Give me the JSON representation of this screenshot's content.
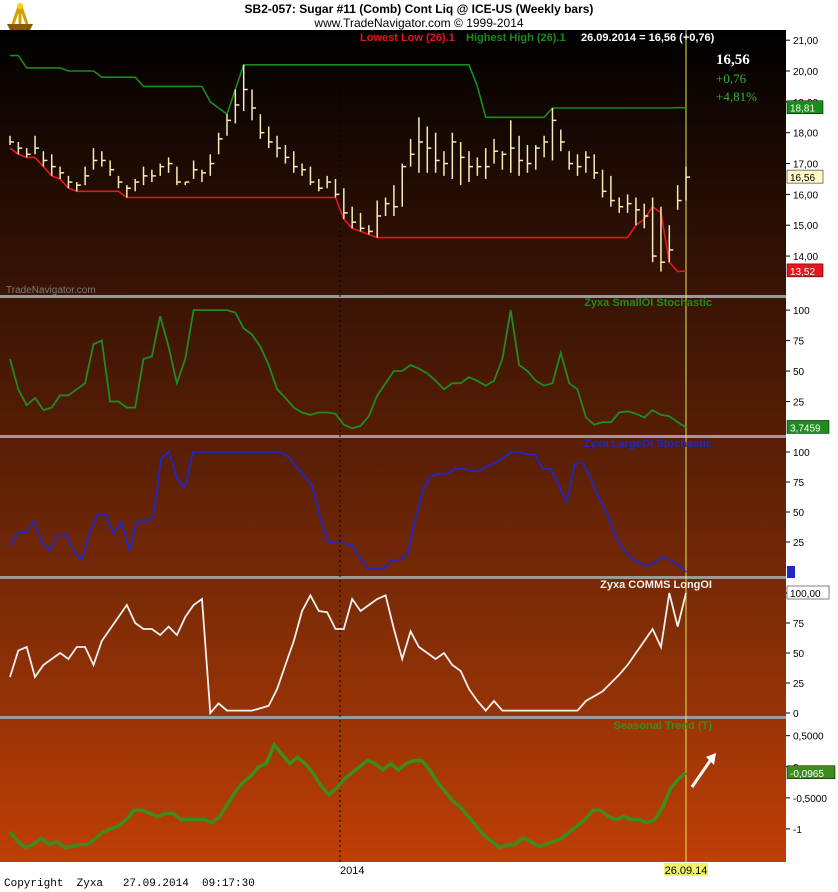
{
  "header": {
    "title": "SB2-057:  Sugar #11 (Comb) Cont Liq @ ICE-US  (Weekly bars)",
    "subtitle": "www.TradeNavigator.com © 1999-2014"
  },
  "footer": {
    "copyright": "Copyright  Zyxa   27.09.2014  09:17:30"
  },
  "colors": {
    "price_bar": "#f4eeb4",
    "lowest_low": "#e8141e",
    "highest_high": "#198c19",
    "small_oi": "#1e8c1e",
    "large_oi": "#1e28c8",
    "comms": "#f0f0f0",
    "seasonal": "#3c8c1e",
    "cursor": "#e6e650",
    "separator": "#9a9a9a"
  },
  "chart_data": [
    {
      "type": "ohlc",
      "panel": "price",
      "legend": {
        "lowest_low": "Lowest Low (26).1",
        "highest_high": "Highest High (26).1",
        "cursor_info": "26.09.2014 = 16,56 (+0,76)"
      },
      "watermark": "TradeNavigator.com",
      "quote": {
        "last": "16,56",
        "change": "+0,76",
        "change_pct": "+4,81%"
      },
      "ylim": [
        12.9,
        21.2
      ],
      "yticks": [
        "21,00",
        "20,00",
        "19,00",
        "18,00",
        "17,00",
        "16,00",
        "15,00",
        "14,00"
      ],
      "year_marker": "2014",
      "cursor_date": "26.09.14",
      "bars_high": [
        17.9,
        17.7,
        17.5,
        17.9,
        17.4,
        17.3,
        16.9,
        16.6,
        16.4,
        16.9,
        17.5,
        17.4,
        17.1,
        16.6,
        16.3,
        16.5,
        16.9,
        16.8,
        17.0,
        17.2,
        16.9,
        16.4,
        17.1,
        16.8,
        17.3,
        18.0,
        18.6,
        19.4,
        20.2,
        19.4,
        18.6,
        18.2,
        17.9,
        17.6,
        17.4,
        17.0,
        16.9,
        16.5,
        16.6,
        16.5,
        16.2,
        15.6,
        15.4,
        15.0,
        15.8,
        15.9,
        16.3,
        17.0,
        17.8,
        18.5,
        18.2,
        18.0,
        17.4,
        18.0,
        17.7,
        17.4,
        17.2,
        17.5,
        17.8,
        17.4,
        18.4,
        17.9,
        17.6,
        17.6,
        17.9,
        18.8,
        18.1,
        17.4,
        17.3,
        17.4,
        17.3,
        16.8,
        16.6,
        15.9,
        16.0,
        15.9,
        15.7,
        15.9,
        15.6,
        15.0,
        16.3,
        16.9
      ],
      "bars_low": [
        17.6,
        17.3,
        17.2,
        17.3,
        16.9,
        16.6,
        16.5,
        16.2,
        16.1,
        16.3,
        16.8,
        16.9,
        16.6,
        16.2,
        15.9,
        16.1,
        16.3,
        16.4,
        16.6,
        16.7,
        16.3,
        16.3,
        16.5,
        16.4,
        16.6,
        17.3,
        17.9,
        18.3,
        18.7,
        18.4,
        17.8,
        17.5,
        17.2,
        17.0,
        16.7,
        16.6,
        16.3,
        16.1,
        16.2,
        15.9,
        15.2,
        14.9,
        14.8,
        14.7,
        14.6,
        15.3,
        15.3,
        15.6,
        16.9,
        16.7,
        16.7,
        16.7,
        16.6,
        16.5,
        16.3,
        16.4,
        16.6,
        16.5,
        17.0,
        16.8,
        16.7,
        16.6,
        16.7,
        16.8,
        17.2,
        17.1,
        17.4,
        16.8,
        16.6,
        16.7,
        16.5,
        15.9,
        15.6,
        15.4,
        15.4,
        15.0,
        14.9,
        13.8,
        13.5,
        13.8,
        15.5,
        15.8
      ],
      "bars_close": [
        17.7,
        17.5,
        17.3,
        17.5,
        17.1,
        16.9,
        16.7,
        16.4,
        16.3,
        16.6,
        17.1,
        17.1,
        16.8,
        16.4,
        16.2,
        16.4,
        16.6,
        16.6,
        16.9,
        17.0,
        16.4,
        16.4,
        16.8,
        16.7,
        17.0,
        17.8,
        18.4,
        18.9,
        19.4,
        18.8,
        18.0,
        17.7,
        17.5,
        17.2,
        16.9,
        16.8,
        16.4,
        16.2,
        16.4,
        16.0,
        15.4,
        15.1,
        14.9,
        14.8,
        15.3,
        15.7,
        15.6,
        16.9,
        17.3,
        17.7,
        17.5,
        17.1,
        17.0,
        17.7,
        17.2,
        16.9,
        16.9,
        16.9,
        17.4,
        17.3,
        17.5,
        17.1,
        17.0,
        17.5,
        17.7,
        18.4,
        17.7,
        17.0,
        16.9,
        17.2,
        16.7,
        16.1,
        15.8,
        15.6,
        15.7,
        15.5,
        15.3,
        14.0,
        13.8,
        14.2,
        15.8,
        16.56
      ],
      "lowest_low": [
        17.5,
        17.3,
        17.2,
        17.2,
        16.9,
        16.6,
        16.5,
        16.2,
        16.1,
        16.1,
        16.1,
        16.1,
        16.1,
        16.1,
        15.9,
        15.9,
        15.9,
        15.9,
        15.9,
        15.9,
        15.9,
        15.9,
        15.9,
        15.9,
        15.9,
        15.9,
        15.9,
        15.9,
        15.9,
        15.9,
        15.9,
        15.9,
        15.9,
        15.9,
        15.9,
        15.9,
        15.9,
        15.9,
        15.9,
        15.9,
        15.2,
        14.9,
        14.8,
        14.7,
        14.6,
        14.6,
        14.6,
        14.6,
        14.6,
        14.6,
        14.6,
        14.6,
        14.6,
        14.6,
        14.6,
        14.6,
        14.6,
        14.6,
        14.6,
        14.6,
        14.6,
        14.6,
        14.6,
        14.6,
        14.6,
        14.6,
        14.6,
        14.6,
        14.6,
        14.6,
        14.6,
        14.6,
        14.6,
        14.6,
        14.6,
        15.0,
        15.2,
        15.6,
        15.4,
        13.8,
        13.5,
        13.52
      ],
      "highest_high": [
        20.5,
        20.5,
        20.1,
        20.1,
        20.1,
        20.1,
        20.1,
        20.0,
        20.0,
        20.0,
        20.0,
        19.8,
        19.8,
        19.8,
        19.8,
        19.8,
        19.5,
        19.5,
        19.5,
        19.5,
        19.5,
        19.5,
        19.5,
        19.5,
        19.0,
        18.8,
        18.6,
        19.4,
        20.2,
        20.2,
        20.2,
        20.2,
        20.2,
        20.2,
        20.2,
        20.2,
        20.2,
        20.2,
        20.2,
        20.2,
        20.2,
        20.2,
        20.2,
        20.2,
        20.2,
        20.2,
        20.2,
        20.2,
        20.2,
        20.2,
        20.2,
        20.2,
        20.2,
        20.2,
        20.2,
        20.2,
        19.5,
        18.5,
        18.5,
        18.5,
        18.5,
        18.5,
        18.5,
        18.5,
        18.5,
        18.8,
        18.8,
        18.8,
        18.8,
        18.8,
        18.8,
        18.8,
        18.8,
        18.8,
        18.8,
        18.8,
        18.8,
        18.8,
        18.8,
        18.8,
        18.81,
        18.81
      ],
      "value_tags": {
        "highest_high": "18,81",
        "lowest_low": "13,52",
        "last": "16,56"
      }
    },
    {
      "type": "line",
      "panel": "small_oi",
      "title": "Zyxa SmallOI Stochastic",
      "ylim": [
        0,
        105
      ],
      "yticks": [
        "100",
        "75",
        "50",
        "25"
      ],
      "values": [
        60,
        35,
        22,
        28,
        18,
        20,
        30,
        30,
        35,
        40,
        72,
        75,
        25,
        25,
        20,
        20,
        60,
        62,
        95,
        70,
        40,
        60,
        100,
        100,
        100,
        100,
        100,
        98,
        85,
        80,
        70,
        55,
        35,
        28,
        20,
        16,
        14,
        16,
        16,
        15,
        6,
        3,
        5,
        13,
        30,
        40,
        50,
        50,
        55,
        52,
        48,
        42,
        35,
        40,
        40,
        45,
        42,
        38,
        42,
        60,
        100,
        55,
        50,
        42,
        38,
        40,
        65,
        40,
        35,
        12,
        6,
        8,
        8,
        16,
        17,
        15,
        12,
        18,
        14,
        13,
        8,
        3.7459
      ],
      "value_tag": "3,7459"
    },
    {
      "type": "line",
      "panel": "large_oi",
      "title": "Zyxa LargeOI Stochastic",
      "ylim": [
        0,
        105
      ],
      "yticks": [
        "100",
        "75",
        "50",
        "25"
      ],
      "values": [
        22,
        33,
        33,
        42,
        25,
        18,
        30,
        32,
        18,
        10,
        32,
        48,
        48,
        32,
        42,
        18,
        42,
        42,
        45,
        95,
        100,
        78,
        70,
        100,
        100,
        100,
        100,
        100,
        100,
        100,
        100,
        100,
        100,
        100,
        100,
        96,
        88,
        80,
        72,
        45,
        25,
        24,
        24,
        22,
        12,
        3,
        3,
        3,
        10,
        10,
        15,
        45,
        70,
        80,
        82,
        82,
        86,
        86,
        84,
        84,
        88,
        91,
        95,
        100,
        100,
        98,
        98,
        86,
        86,
        72,
        58,
        90,
        91,
        78,
        62,
        50,
        32,
        20,
        12,
        8,
        5,
        8,
        12,
        10,
        6,
        0
      ],
      "value_tag": ""
    },
    {
      "type": "line",
      "panel": "comms",
      "title": "Zyxa COMMS LongOI",
      "ylim": [
        0,
        105
      ],
      "yticks": [
        "100,00",
        "75",
        "50",
        "25",
        "0"
      ],
      "values": [
        30,
        52,
        55,
        30,
        40,
        45,
        50,
        45,
        55,
        55,
        40,
        60,
        70,
        80,
        90,
        75,
        70,
        70,
        65,
        72,
        65,
        80,
        90,
        95,
        0,
        8,
        2,
        2,
        2,
        2,
        4,
        6,
        20,
        40,
        60,
        85,
        98,
        85,
        84,
        70,
        70,
        95,
        85,
        90,
        95,
        98,
        70,
        45,
        68,
        55,
        50,
        45,
        50,
        40,
        35,
        20,
        10,
        2,
        10,
        2,
        2,
        2,
        2,
        2,
        2,
        2,
        2,
        2,
        2,
        10,
        14,
        18,
        25,
        32,
        40,
        50,
        60,
        70,
        55,
        100,
        72,
        100
      ],
      "value_tag": "100,00"
    },
    {
      "type": "line",
      "panel": "seasonal",
      "title": "Seasonal Trend (T)",
      "ylim": [
        -1.5,
        0.72
      ],
      "yticks": [
        "0,5000",
        "0",
        "-0,5000",
        "-1"
      ],
      "values": [
        -1.05,
        -1.2,
        -1.3,
        -1.25,
        -1.15,
        -1.25,
        -1.2,
        -1.3,
        -1.28,
        -1.25,
        -1.25,
        -1.15,
        -1.05,
        -1.0,
        -0.95,
        -0.85,
        -0.7,
        -0.7,
        -0.75,
        -0.8,
        -0.75,
        -0.75,
        -0.85,
        -0.85,
        -0.85,
        -0.85,
        -0.9,
        -0.8,
        -0.6,
        -0.4,
        -0.25,
        -0.15,
        0.0,
        0.05,
        0.35,
        0.2,
        0.05,
        0.15,
        0.05,
        -0.1,
        -0.3,
        -0.45,
        -0.35,
        -0.2,
        -0.1,
        0.0,
        0.1,
        0.05,
        -0.05,
        0.05,
        -0.05,
        0.05,
        0.1,
        0.1,
        -0.05,
        -0.25,
        -0.4,
        -0.55,
        -0.65,
        -0.8,
        -0.95,
        -1.1,
        -1.2,
        -1.3,
        -1.25,
        -1.25,
        -1.15,
        -1.2,
        -1.28,
        -1.25,
        -1.2,
        -1.15,
        -1.05,
        -0.95,
        -0.85,
        -0.7,
        -0.7,
        -0.8,
        -0.85,
        -0.8,
        -0.85,
        -0.85,
        -0.9,
        -0.85,
        -0.65,
        -0.35,
        -0.2,
        -0.0965
      ],
      "value_tag": "-0,0965"
    }
  ]
}
